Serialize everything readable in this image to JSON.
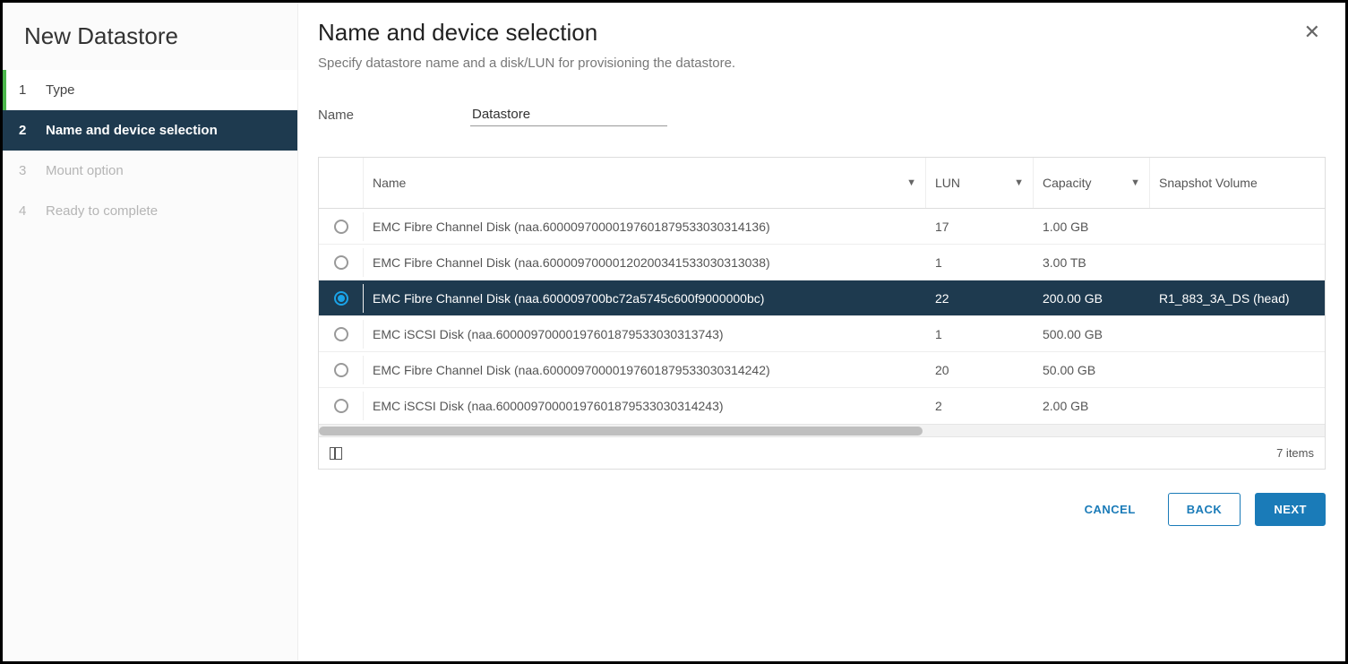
{
  "wizard": {
    "title": "New Datastore",
    "steps": [
      {
        "num": "1",
        "label": "Type",
        "state": "completed"
      },
      {
        "num": "2",
        "label": "Name and device selection",
        "state": "active"
      },
      {
        "num": "3",
        "label": "Mount option",
        "state": "disabled"
      },
      {
        "num": "4",
        "label": "Ready to complete",
        "state": "disabled"
      }
    ]
  },
  "page": {
    "title": "Name and device selection",
    "subtitle": "Specify datastore name and a disk/LUN for provisioning the datastore.",
    "name_label": "Name",
    "name_value": "Datastore"
  },
  "table": {
    "columns": {
      "name": "Name",
      "lun": "LUN",
      "capacity": "Capacity",
      "snapshot": "Snapshot Volume"
    },
    "rows": [
      {
        "name": "EMC Fibre Channel Disk (naa.600009700001976018795330303141​36)",
        "lun": "17",
        "capacity": "1.00 GB",
        "snapshot": "",
        "selected": false
      },
      {
        "name": "EMC Fibre Channel Disk (naa.6000097000012020034153303031​3038)",
        "lun": "1",
        "capacity": "3.00 TB",
        "snapshot": "",
        "selected": false
      },
      {
        "name": "EMC Fibre Channel Disk (naa.600009700bc72a5745c600f90000​00bc)",
        "lun": "22",
        "capacity": "200.00 GB",
        "snapshot": "R1_883_3A_DS (head)",
        "selected": true
      },
      {
        "name": "EMC iSCSI Disk (naa.6000097000019760187953303031​3743)",
        "lun": "1",
        "capacity": "500.00 GB",
        "snapshot": "",
        "selected": false
      },
      {
        "name": "EMC Fibre Channel Disk (naa.6000097000019760187953303031​4242)",
        "lun": "20",
        "capacity": "50.00 GB",
        "snapshot": "",
        "selected": false
      },
      {
        "name": "EMC iSCSI Disk (naa.6000097000019760187953303031​4243)",
        "lun": "2",
        "capacity": "2.00 GB",
        "snapshot": "",
        "selected": false
      }
    ],
    "footer_count": "7 items"
  },
  "footer": {
    "cancel": "CANCEL",
    "back": "BACK",
    "next": "NEXT"
  }
}
